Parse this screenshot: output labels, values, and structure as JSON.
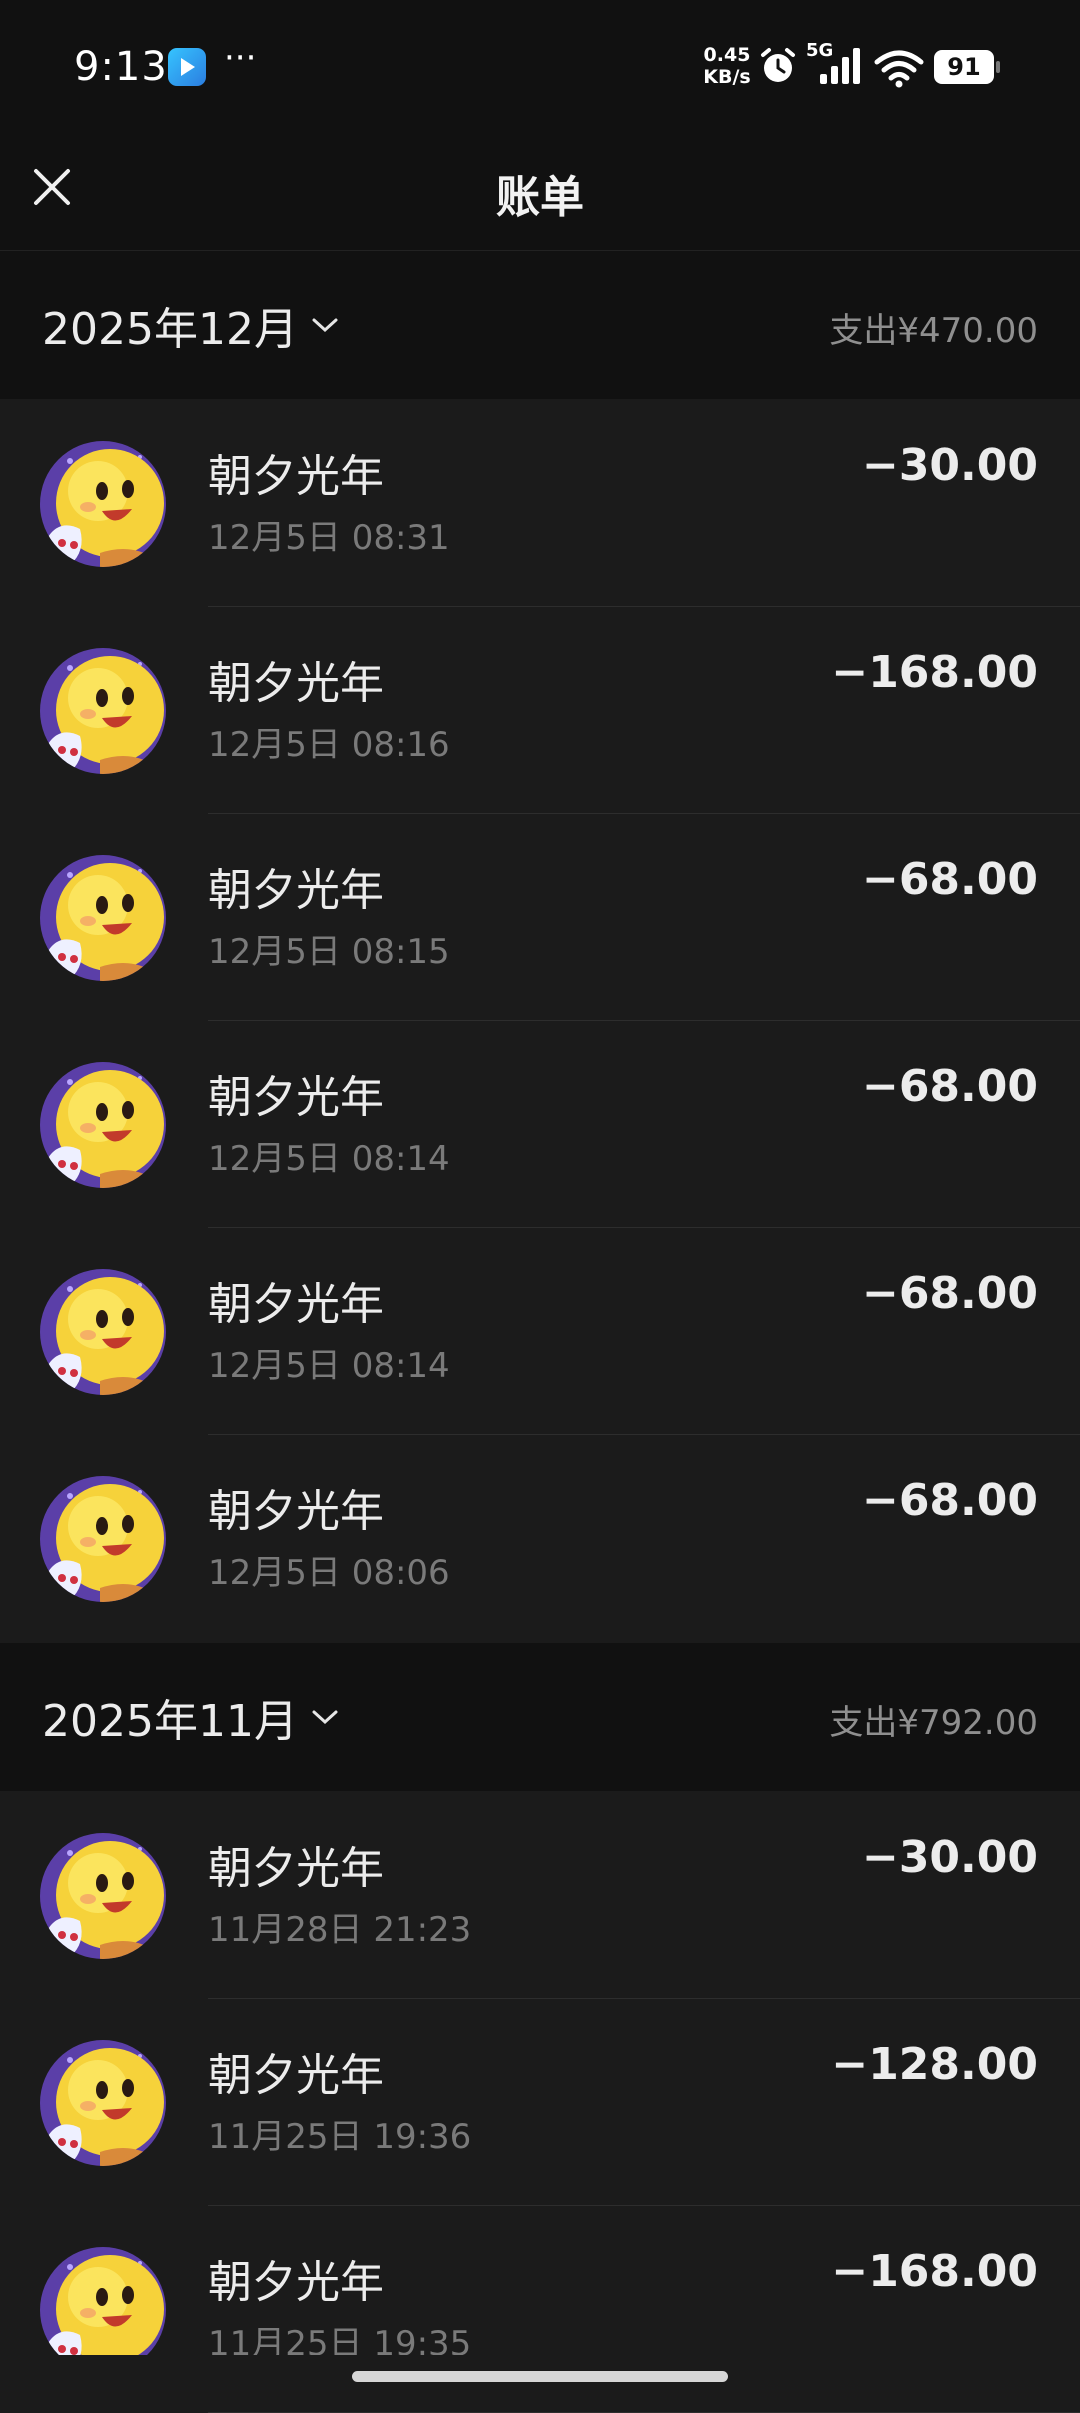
{
  "status_bar": {
    "time": "9:13",
    "more": "···",
    "net_speed_value": "0.45",
    "net_speed_unit": "KB/s",
    "network": "5G",
    "battery": "91",
    "icons": [
      "app-video-icon",
      "alarm-icon",
      "signal-icon",
      "wifi-icon",
      "battery-icon"
    ]
  },
  "header": {
    "title": "账单",
    "close_icon": "close-icon"
  },
  "colors": {
    "background": "#1b1b1b",
    "header_bg": "#111111",
    "text_primary": "#ececec",
    "text_secondary": "#7a7a7a"
  },
  "months": [
    {
      "label": "2025年12月",
      "total": "支出¥470.00",
      "transactions": [
        {
          "merchant": "朝夕光年",
          "time": "12月5日 08:31",
          "amount": "−30.00"
        },
        {
          "merchant": "朝夕光年",
          "time": "12月5日 08:16",
          "amount": "−168.00"
        },
        {
          "merchant": "朝夕光年",
          "time": "12月5日 08:15",
          "amount": "−68.00"
        },
        {
          "merchant": "朝夕光年",
          "time": "12月5日 08:14",
          "amount": "−68.00"
        },
        {
          "merchant": "朝夕光年",
          "time": "12月5日 08:14",
          "amount": "−68.00"
        },
        {
          "merchant": "朝夕光年",
          "time": "12月5日 08:06",
          "amount": "−68.00"
        }
      ]
    },
    {
      "label": "2025年11月",
      "total": "支出¥792.00",
      "transactions": [
        {
          "merchant": "朝夕光年",
          "time": "11月28日 21:23",
          "amount": "−30.00"
        },
        {
          "merchant": "朝夕光年",
          "time": "11月25日 19:36",
          "amount": "−128.00"
        },
        {
          "merchant": "朝夕光年",
          "time": "11月25日 19:35",
          "amount": "−168.00"
        }
      ]
    }
  ]
}
